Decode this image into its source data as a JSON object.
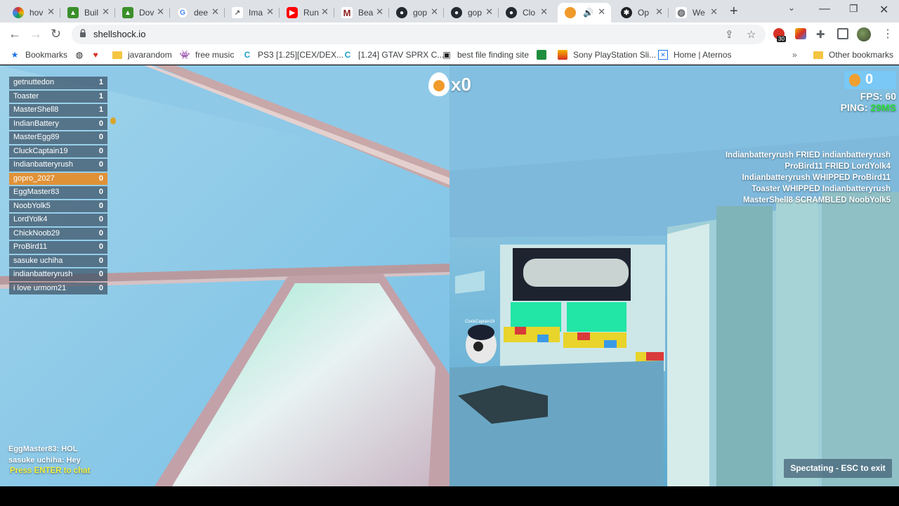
{
  "browser": {
    "tabs": [
      {
        "label": "hov",
        "icon": "multicolor-logo-icon",
        "color": "#d93025"
      },
      {
        "label": "Buil",
        "icon": "game-icon",
        "color": "#3a8f2a"
      },
      {
        "label": "Dov",
        "icon": "game-icon",
        "color": "#3a8f2a"
      },
      {
        "label": "dee",
        "icon": "google-icon",
        "color": "#4285f4"
      },
      {
        "label": "Ima",
        "icon": "chart-icon",
        "color": "#5f6368"
      },
      {
        "label": "Run",
        "icon": "youtube-icon",
        "color": "#ff0000"
      },
      {
        "label": "Bea",
        "icon": "m-logo-icon",
        "color": "#8b1a1a"
      },
      {
        "label": "gop",
        "icon": "github-icon",
        "color": "#24292f"
      },
      {
        "label": "gop",
        "icon": "github-icon",
        "color": "#24292f"
      },
      {
        "label": "Clo",
        "icon": "github-icon",
        "color": "#24292f"
      },
      {
        "label": "",
        "icon": "shellshock-icon",
        "color": "#f09a2a",
        "active": true
      },
      {
        "label": "Op",
        "icon": "openai-icon",
        "color": "#202124"
      },
      {
        "label": "We",
        "icon": "globe-icon",
        "color": "#5f6368"
      }
    ],
    "url": "shellshock.io",
    "extension_badge": "30",
    "bookmarks": [
      {
        "label": "Bookmarks",
        "icon": "star-icon"
      },
      {
        "label": "",
        "icon": "globe-icon"
      },
      {
        "label": "",
        "icon": "heart-icon"
      },
      {
        "label": "javarandom",
        "icon": "folder-icon"
      },
      {
        "label": "free music",
        "icon": "alien-icon"
      },
      {
        "label": "PS3 [1.25][CEX/DEX...",
        "icon": "c-logo-icon"
      },
      {
        "label": "[1.24] GTAV SPRX C...",
        "icon": "c-logo-icon"
      },
      {
        "label": "best file finding site",
        "icon": "robot-icon"
      },
      {
        "label": "",
        "icon": "green-square-icon"
      },
      {
        "label": "Sony PlayStation Sli...",
        "icon": "shopping-bag-icon"
      },
      {
        "label": "Home | Aternos",
        "icon": "aternos-icon"
      }
    ],
    "other_bookmarks": "Other bookmarks"
  },
  "game": {
    "scoreboard": [
      {
        "name": "getnuttedon",
        "score": "1"
      },
      {
        "name": "Toaster",
        "score": "1"
      },
      {
        "name": "MasterShell8",
        "score": "1"
      },
      {
        "name": "IndianBattery",
        "score": "0"
      },
      {
        "name": "MasterEgg89",
        "score": "0"
      },
      {
        "name": "CluckCaptain19",
        "score": "0"
      },
      {
        "name": "Indianbatteryrush",
        "score": "0"
      },
      {
        "name": "gopro_2027",
        "score": "0",
        "me": true
      },
      {
        "name": "EggMaster83",
        "score": "0"
      },
      {
        "name": "NoobYolk5",
        "score": "0"
      },
      {
        "name": "LordYolk4",
        "score": "0"
      },
      {
        "name": "ChickNoob29",
        "score": "0"
      },
      {
        "name": "ProBird11",
        "score": "0"
      },
      {
        "name": "sasuke uchiha",
        "score": "0"
      },
      {
        "name": "indianbatteryrush",
        "score": "0"
      },
      {
        "name": "i love urmom21",
        "score": "0"
      }
    ],
    "kill_count": "x0",
    "eggs": "0",
    "fps_label": "FPS: 60",
    "ping_label": "PING: ",
    "ping_value": "29MS",
    "killfeed": [
      "Indianbatteryrush FRIED indianbatteryrush",
      "ProBird11 FRIED LordYolk4",
      "Indianbatteryrush WHIPPED ProBird11",
      "Toaster WHIPPED Indianbatteryrush",
      "MasterShell8 SCRAMBLED NoobYolk5"
    ],
    "chat": [
      "EggMaster83: HOL",
      "sasuke uchiha: Hey"
    ],
    "chat_prompt": "Press ENTER to chat",
    "player_tag": "CluckCaptain19",
    "spectate_label": "Spectating - ESC to exit",
    "colors": {
      "me_row": "#e68c28",
      "ping_value": "#30e040",
      "chat_prompt": "#f0f040"
    }
  }
}
